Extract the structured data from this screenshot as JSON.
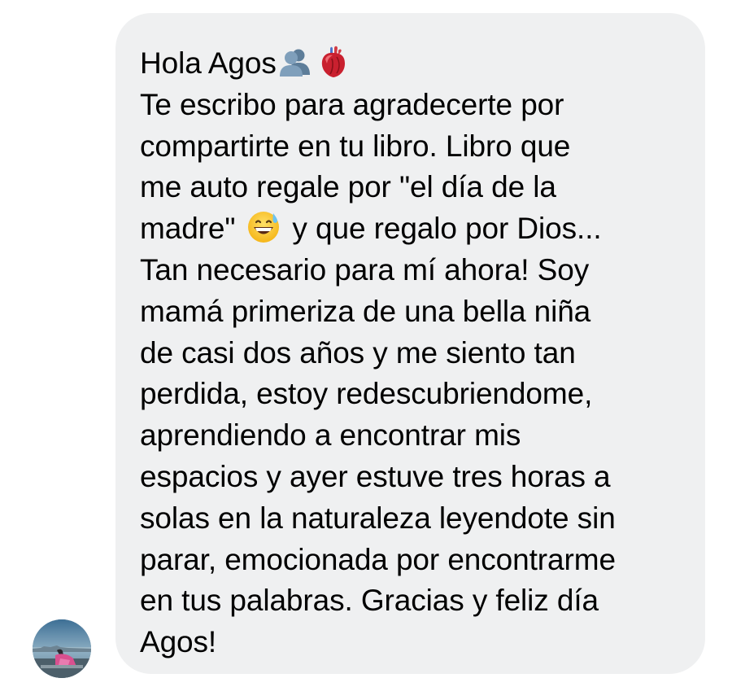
{
  "sender": {
    "avatar_icon": "profile-photo-icon"
  },
  "message": {
    "greeting": "Hola Agos",
    "greeting_emojis": [
      "busts-in-silhouette-icon",
      "anatomical-heart-icon"
    ],
    "lines": [
      "Te escribo para agradecerte por",
      "compartirte en tu libro. Libro que",
      "me auto regale por \"el día de la",
      "madre\"",
      "y que regalo por Dios...",
      "Tan necesario para mí ahora! Soy",
      "mamá primeriza de una bella niña",
      "de casi dos años y me siento tan",
      "perdida, estoy redescubriendome,",
      "aprendiendo a encontrar mis",
      "espacios y ayer estuve tres horas a",
      "solas en la naturaleza leyendote sin",
      "parar, emocionada por encontrarme",
      "en tus palabras. Gracias y feliz día",
      "Agos!"
    ],
    "inline_emoji": "grinning-face-with-sweat-icon"
  },
  "colors": {
    "bubble": "#eff0f1",
    "text": "#000000",
    "background": "#ffffff"
  }
}
